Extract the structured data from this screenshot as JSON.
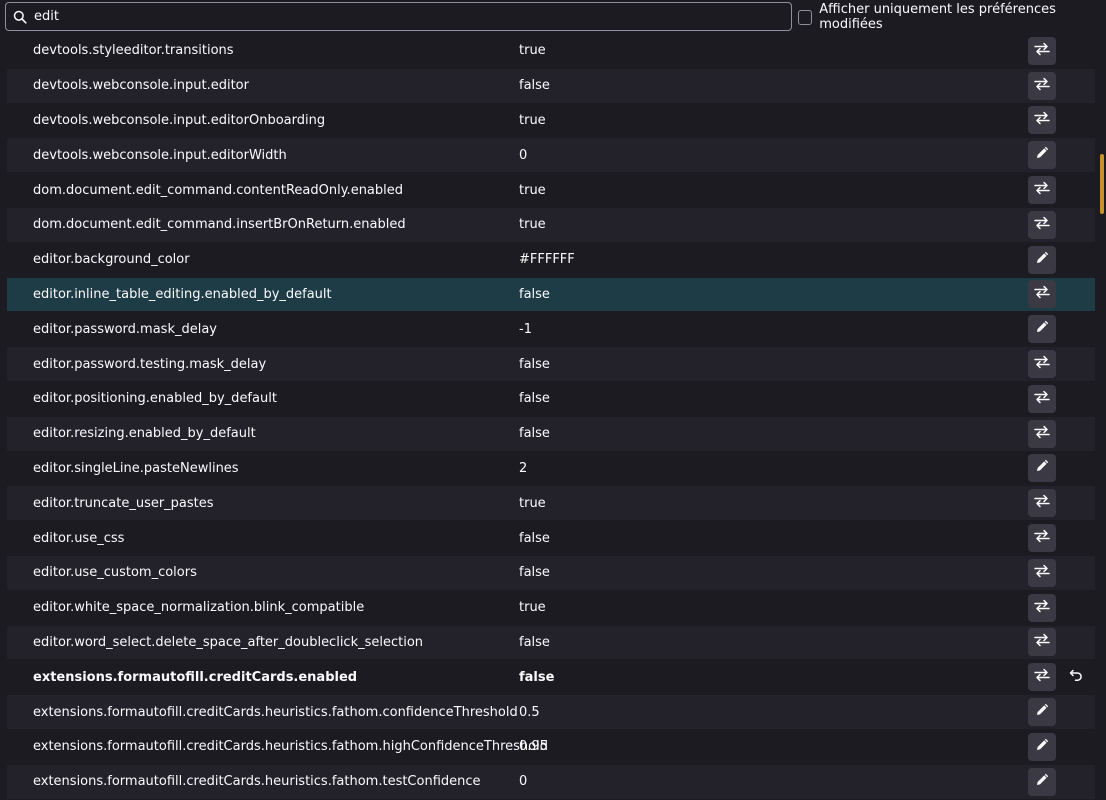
{
  "search": {
    "value": "edit",
    "placeholder": ""
  },
  "filter": {
    "label": "Afficher uniquement les préférences modifiées",
    "checked": false
  },
  "colors": {
    "background": "#1c1b22",
    "row_alt": "#23222b",
    "selected_row": "#1d3c46",
    "button": "#3a3944",
    "scroll_accent": "#c6912e"
  },
  "prefs": [
    {
      "name": "devtools.styleeditor.transitions",
      "value": "true",
      "action": "toggle-icon"
    },
    {
      "name": "devtools.webconsole.input.editor",
      "value": "false",
      "action": "toggle-icon"
    },
    {
      "name": "devtools.webconsole.input.editorOnboarding",
      "value": "true",
      "action": "toggle-icon"
    },
    {
      "name": "devtools.webconsole.input.editorWidth",
      "value": "0",
      "action": "edit-icon"
    },
    {
      "name": "dom.document.edit_command.contentReadOnly.enabled",
      "value": "true",
      "action": "toggle-icon"
    },
    {
      "name": "dom.document.edit_command.insertBrOnReturn.enabled",
      "value": "true",
      "action": "toggle-icon"
    },
    {
      "name": "editor.background_color",
      "value": "#FFFFFF",
      "action": "edit-icon"
    },
    {
      "name": "editor.inline_table_editing.enabled_by_default",
      "value": "false",
      "action": "toggle-icon",
      "selected": true
    },
    {
      "name": "editor.password.mask_delay",
      "value": "-1",
      "action": "edit-icon"
    },
    {
      "name": "editor.password.testing.mask_delay",
      "value": "false",
      "action": "toggle-icon"
    },
    {
      "name": "editor.positioning.enabled_by_default",
      "value": "false",
      "action": "toggle-icon"
    },
    {
      "name": "editor.resizing.enabled_by_default",
      "value": "false",
      "action": "toggle-icon"
    },
    {
      "name": "editor.singleLine.pasteNewlines",
      "value": "2",
      "action": "edit-icon"
    },
    {
      "name": "editor.truncate_user_pastes",
      "value": "true",
      "action": "toggle-icon"
    },
    {
      "name": "editor.use_css",
      "value": "false",
      "action": "toggle-icon"
    },
    {
      "name": "editor.use_custom_colors",
      "value": "false",
      "action": "toggle-icon"
    },
    {
      "name": "editor.white_space_normalization.blink_compatible",
      "value": "true",
      "action": "toggle-icon"
    },
    {
      "name": "editor.word_select.delete_space_after_doubleclick_selection",
      "value": "false",
      "action": "toggle-icon"
    },
    {
      "name": "extensions.formautofill.creditCards.enabled",
      "value": "false",
      "action": "toggle-icon",
      "modified": true
    },
    {
      "name": "extensions.formautofill.creditCards.heuristics.fathom.confidenceThreshold",
      "value": "0.5",
      "action": "edit-icon"
    },
    {
      "name": "extensions.formautofill.creditCards.heuristics.fathom.highConfidenceThreshold",
      "value": "0.95",
      "action": "edit-icon"
    },
    {
      "name": "extensions.formautofill.creditCards.heuristics.fathom.testConfidence",
      "value": "0",
      "action": "edit-icon"
    }
  ]
}
